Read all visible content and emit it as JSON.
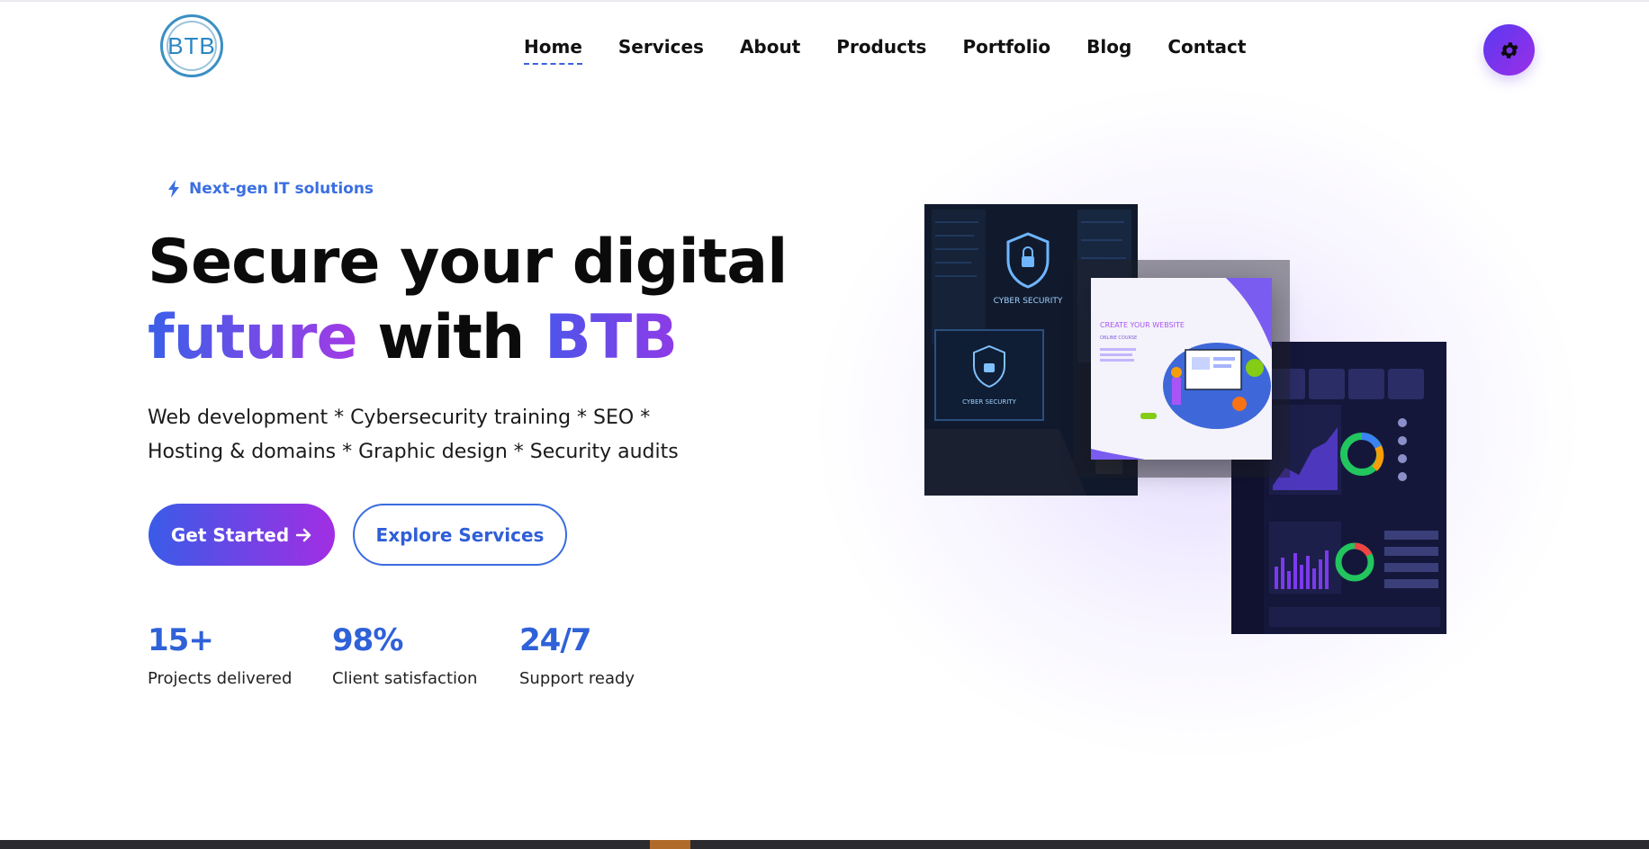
{
  "brand": {
    "logo_text": "BTB"
  },
  "nav": {
    "items": [
      {
        "label": "Home",
        "active": true
      },
      {
        "label": "Services",
        "active": false
      },
      {
        "label": "About",
        "active": false
      },
      {
        "label": "Products",
        "active": false
      },
      {
        "label": "Portfolio",
        "active": false
      },
      {
        "label": "Blog",
        "active": false
      },
      {
        "label": "Contact",
        "active": false
      }
    ],
    "settings_icon": "gear-icon"
  },
  "hero": {
    "tag": "Next-gen IT solutions",
    "tag_icon": "bolt-icon",
    "title_line1": "Secure your digital",
    "title_word_future": "future",
    "title_word_with": "with",
    "title_word_brand": "BTB",
    "subtitle_line1": "Web development * Cybersecurity training * SEO *",
    "subtitle_line2": "Hosting & domains * Graphic design * Security audits",
    "primary_button": "Get Started",
    "primary_button_icon": "arrow-right-icon",
    "secondary_button": "Explore Services"
  },
  "stats": [
    {
      "value": "15+",
      "label": "Projects delivered"
    },
    {
      "value": "98%",
      "label": "Client satisfaction"
    },
    {
      "value": "24/7",
      "label": "Support ready"
    }
  ],
  "visuals": {
    "cyber_caption_1": "CYBER SECURITY",
    "cyber_caption_2": "CYBER SECURITY",
    "web_title": "CREATE YOUR WEBSITE",
    "web_subtitle": "ONLINE COURSE"
  },
  "colors": {
    "accent_blue": "#3a6fe0",
    "accent_purple": "#a23be5",
    "stat_blue": "#2f61d8"
  }
}
